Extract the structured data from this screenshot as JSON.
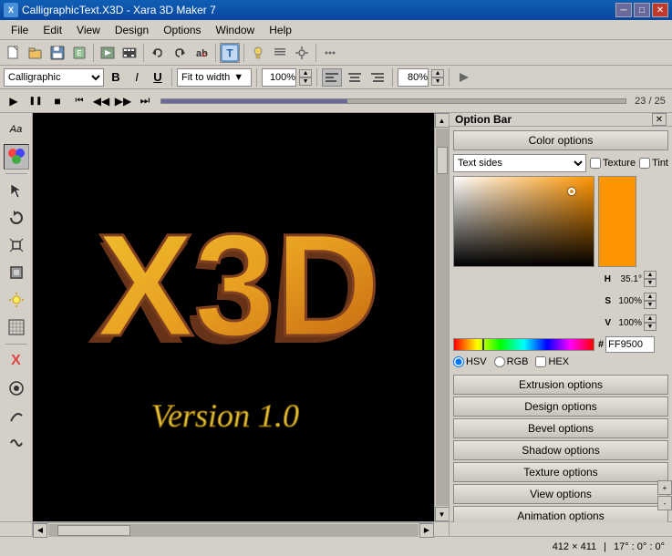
{
  "window": {
    "title": "CalligraphicText.X3D - Xara 3D Maker 7",
    "icon": "X"
  },
  "title_controls": {
    "minimize": "─",
    "maximize": "□",
    "close": "✕"
  },
  "menu": {
    "items": [
      "File",
      "Edit",
      "View",
      "Design",
      "Options",
      "Window",
      "Help"
    ]
  },
  "toolbar1": {
    "undo_tooltip": "Undo",
    "redo_tooltip": "Redo"
  },
  "toolbar2": {
    "font_name": "Calligraphic",
    "bold_label": "B",
    "italic_label": "I",
    "underline_label": "U",
    "fit_label": "Fit to width",
    "zoom_value": "100%",
    "zoom_pct": "80%"
  },
  "animation_toolbar": {
    "play_icon": "▶",
    "pause_icon": "❚❚",
    "stop_icon": "■",
    "rewind_icon": "⏮",
    "back_icon": "◀◀",
    "forward_icon": "▶▶",
    "end_icon": "⏭",
    "frame_current": "23",
    "frame_total": "25",
    "frame_display": "23 / 25"
  },
  "left_tools": {
    "items": [
      {
        "name": "font-tool",
        "icon": "Aa"
      },
      {
        "name": "color-tool",
        "icon": "🎨"
      },
      {
        "name": "cursor-tool",
        "icon": "↖"
      },
      {
        "name": "rotate-tool",
        "icon": "↻"
      },
      {
        "name": "extrude-tool",
        "icon": "⬡"
      },
      {
        "name": "bevel-tool",
        "icon": "◈"
      },
      {
        "name": "light-tool",
        "icon": "✦"
      },
      {
        "name": "texture-tool",
        "icon": "▦"
      },
      {
        "name": "shadow-tool",
        "icon": "◑"
      },
      {
        "name": "x-btn",
        "icon": "X"
      },
      {
        "name": "anim-tool",
        "icon": "○"
      },
      {
        "name": "path-tool",
        "icon": "∫"
      },
      {
        "name": "fx-tool",
        "icon": "∞"
      }
    ]
  },
  "canvas": {
    "main_text": "X3D",
    "sub_text": "Version 1.0"
  },
  "right_panel": {
    "title": "Option Bar",
    "close_icon": "✕"
  },
  "color_options": {
    "section_label": "Color options",
    "dropdown_value": "Text sides",
    "texture_label": "Texture",
    "tint_label": "Tint",
    "hsv_label": "HSV",
    "rgb_label": "RGB",
    "hex_label": "HEX",
    "h_label": "H",
    "s_label": "S",
    "v_label": "V",
    "h_value": "35.1°",
    "s_value": "100%",
    "v_value": "100%",
    "hex_value": "FF9500",
    "hash_symbol": "#"
  },
  "option_buttons": [
    {
      "label": "Extrusion options",
      "name": "extrusion-options-btn"
    },
    {
      "label": "Design options",
      "name": "design-options-btn"
    },
    {
      "label": "Bevel options",
      "name": "bevel-options-btn"
    },
    {
      "label": "Shadow options",
      "name": "shadow-options-btn"
    },
    {
      "label": "Texture options",
      "name": "texture-options-btn"
    },
    {
      "label": "View options",
      "name": "view-options-btn"
    },
    {
      "label": "Animation options",
      "name": "animation-options-btn"
    }
  ],
  "status_bar": {
    "size": "412 × 411",
    "rotation": "17° : 0° : 0°"
  },
  "hscrollbar": {
    "left_arrow": "◀",
    "right_arrow": "▶"
  }
}
